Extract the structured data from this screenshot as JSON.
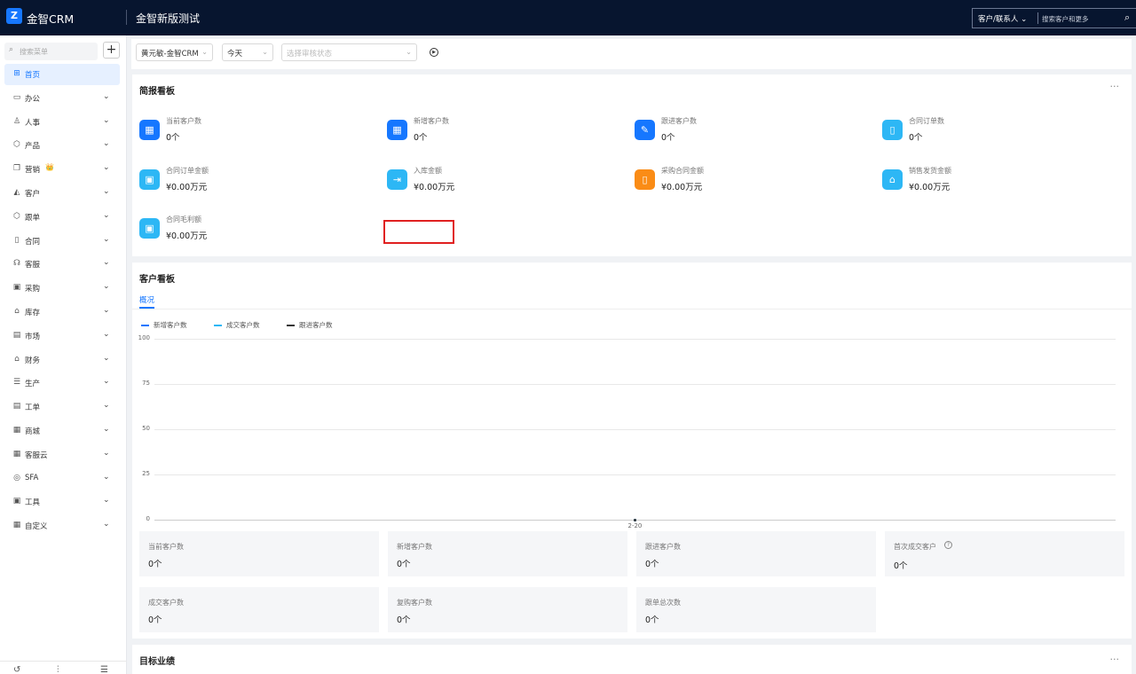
{
  "topbar": {
    "logo_glyph": "Z",
    "brand": "金智CRM",
    "page_title": "金智新版测试",
    "search_scope": "客户/联系人",
    "search_placeholder": "搜索客户和更多",
    "search_icon": "search-icon"
  },
  "sidebar": {
    "search_placeholder": "搜索菜单",
    "add_label": "+",
    "items": [
      {
        "label": "首页",
        "icon": "grid-icon",
        "glyph": "⊞"
      },
      {
        "label": "办公",
        "icon": "office-icon",
        "glyph": "▭"
      },
      {
        "label": "人事",
        "icon": "people-icon",
        "glyph": "♙"
      },
      {
        "label": "产品",
        "icon": "box-icon",
        "glyph": "⬡"
      },
      {
        "label": "营销",
        "icon": "marketing-icon",
        "glyph": "❐",
        "badge": "👑"
      },
      {
        "label": "客户",
        "icon": "customer-icon",
        "glyph": "◭"
      },
      {
        "label": "跟单",
        "icon": "follow-icon",
        "glyph": "⬡"
      },
      {
        "label": "合同",
        "icon": "contract-icon",
        "glyph": "▯"
      },
      {
        "label": "客服",
        "icon": "headset-icon",
        "glyph": "☊"
      },
      {
        "label": "采购",
        "icon": "purchase-icon",
        "glyph": "▣"
      },
      {
        "label": "库存",
        "icon": "warehouse-icon",
        "glyph": "⌂"
      },
      {
        "label": "市场",
        "icon": "market-icon",
        "glyph": "▤"
      },
      {
        "label": "财务",
        "icon": "finance-icon",
        "glyph": "⌂"
      },
      {
        "label": "生产",
        "icon": "production-icon",
        "glyph": "☰"
      },
      {
        "label": "工单",
        "icon": "ticket-icon",
        "glyph": "▤"
      },
      {
        "label": "商城",
        "icon": "mall-icon",
        "glyph": "▦"
      },
      {
        "label": "客服云",
        "icon": "cloud-service-icon",
        "glyph": "▦"
      },
      {
        "label": "SFA",
        "icon": "sfa-icon",
        "glyph": "◎"
      },
      {
        "label": "工具",
        "icon": "tools-icon",
        "glyph": "▣"
      },
      {
        "label": "自定义",
        "icon": "custom-icon",
        "glyph": "▦"
      }
    ],
    "bottom_icons": [
      {
        "icon": "history-icon",
        "glyph": "↺"
      },
      {
        "icon": "settings-sliders-icon",
        "glyph": "⫶"
      },
      {
        "icon": "filter-list-icon",
        "glyph": "☰"
      }
    ]
  },
  "filters": {
    "user": "黄元敏-金智CRM",
    "period": "今天",
    "status_placeholder": "选择审核状态"
  },
  "brief_board": {
    "title": "简报看板",
    "more": "···",
    "stats": [
      {
        "label": "当前客户数",
        "value": "0个",
        "color": "#1677ff",
        "glyph": "▦",
        "icon": "customers-icon"
      },
      {
        "label": "新增客户数",
        "value": "0个",
        "color": "#1677ff",
        "glyph": "▦",
        "icon": "new-customers-icon"
      },
      {
        "label": "跟进客户数",
        "value": "0个",
        "color": "#1677ff",
        "glyph": "✎",
        "icon": "follow-up-icon"
      },
      {
        "label": "合同订单数",
        "value": "0个",
        "color": "#2db7f5",
        "glyph": "▯",
        "icon": "contract-orders-icon"
      },
      {
        "label": "合同订单金额",
        "value": "¥0.00万元",
        "color": "#2db7f5",
        "glyph": "▣",
        "icon": "contract-amount-icon"
      },
      {
        "label": "入库金额",
        "value": "¥0.00万元",
        "color": "#2db7f5",
        "glyph": "⇥",
        "icon": "inbound-icon"
      },
      {
        "label": "采购合同金额",
        "value": "¥0.00万元",
        "color": "#fa8c16",
        "glyph": "▯",
        "icon": "purchase-contract-icon"
      },
      {
        "label": "销售发货金额",
        "value": "¥0.00万元",
        "color": "#2db7f5",
        "glyph": "⌂",
        "icon": "shipment-icon"
      },
      {
        "label": "合同毛利额",
        "value": "¥0.00万元",
        "color": "#2db7f5",
        "glyph": "▣",
        "icon": "gross-profit-icon"
      }
    ]
  },
  "customer_board": {
    "title": "客户看板",
    "tab": "概况",
    "chart_data": {
      "type": "line",
      "x": [
        "2-20"
      ],
      "series": [
        {
          "name": "新增客户数",
          "values": [
            0
          ],
          "color": "#1677ff"
        },
        {
          "name": "成交客户数",
          "values": [
            0
          ],
          "color": "#2db7f5"
        },
        {
          "name": "跟进客户数",
          "values": [
            0
          ],
          "color": "#333333"
        }
      ],
      "yticks": [
        0,
        25,
        50,
        75,
        100
      ],
      "ylim": [
        0,
        100
      ],
      "grid": true,
      "legend": "top-left"
    },
    "metrics": [
      {
        "label": "当前客户数",
        "value": "0个"
      },
      {
        "label": "新增客户数",
        "value": "0个"
      },
      {
        "label": "跟进客户数",
        "value": "0个"
      },
      {
        "label": "首次成交客户",
        "value": "0个",
        "help": "?"
      },
      {
        "label": "成交客户数",
        "value": "0个"
      },
      {
        "label": "复购客户数",
        "value": "0个"
      },
      {
        "label": "跟单总次数",
        "value": "0个"
      }
    ]
  },
  "target_board": {
    "title": "目标业绩",
    "more": "···"
  }
}
